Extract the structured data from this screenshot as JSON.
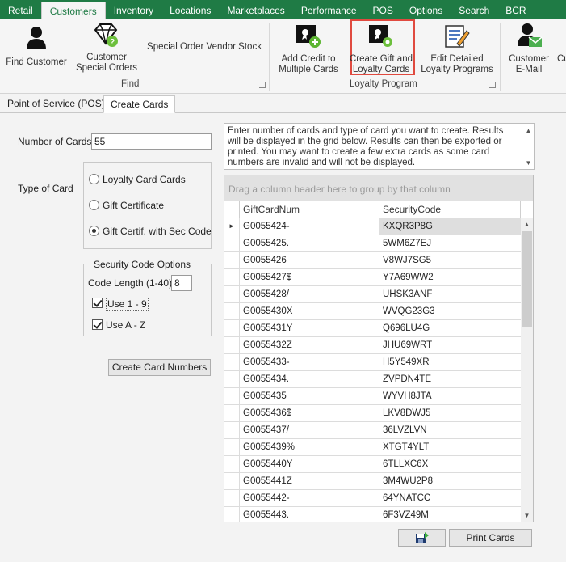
{
  "menu": {
    "tabs": [
      "Retail",
      "Customers",
      "Inventory",
      "Locations",
      "Marketplaces",
      "Performance",
      "POS",
      "Options",
      "Search",
      "BCR"
    ],
    "active_index": 1
  },
  "ribbon": {
    "find_group": {
      "label": "Find",
      "find_customer": "Find Customer",
      "customer_special_orders_1": "Customer",
      "customer_special_orders_2": "Special Orders",
      "special_order_vendor_stock": "Special Order Vendor Stock"
    },
    "loyalty_group": {
      "label": "Loyalty Program",
      "add_credit_1": "Add Credit to",
      "add_credit_2": "Multiple Cards",
      "create_gift_1": "Create Gift and",
      "create_gift_2": "Loyalty Cards",
      "edit_detailed_1": "Edit Detailed",
      "edit_detailed_2": "Loyalty Programs"
    },
    "customer_email_1": "Customer",
    "customer_email_2": "E-Mail",
    "cut_off": "Cu"
  },
  "subtabs": [
    "Point of Service (POS)",
    "Create Cards"
  ],
  "form": {
    "number_of_cards_label": "Number of Cards",
    "number_of_cards_value": "55",
    "type_of_card_label": "Type of Card",
    "card_types": [
      "Loyalty Card Cards",
      "Gift Certificate",
      "Gift Certif. with Sec Code"
    ],
    "selected_card_type": 2,
    "security_code_options_label": "Security Code Options",
    "code_length_label": "Code Length (1-40)",
    "code_length_value": "8",
    "use_1_9_label": "Use 1 - 9",
    "use_a_z_label": "Use A - Z",
    "create_button": "Create Card Numbers"
  },
  "info_text_lines": [
    "Enter number of cards and type of card you want to create.  Results",
    "will be displayed in the grid below.  Results can then be exported or",
    "printed.  You may want to create a few extra cards as some card",
    "numbers are invalid and will not be displayed."
  ],
  "grid": {
    "group_panel_text": "Drag a column header here to group by that column",
    "columns": [
      "GiftCardNum",
      "SecurityCode"
    ],
    "rows": [
      [
        "G0055424-",
        "KXQR3P8G"
      ],
      [
        "G0055425.",
        "5WM6Z7EJ"
      ],
      [
        "G0055426",
        "V8WJ7SG5"
      ],
      [
        "G0055427$",
        "Y7A69WW2"
      ],
      [
        "G0055428/",
        "UHSK3ANF"
      ],
      [
        "G0055430X",
        "WVQG23G3"
      ],
      [
        "G0055431Y",
        "Q696LU4G"
      ],
      [
        "G0055432Z",
        "JHU69WRT"
      ],
      [
        "G0055433-",
        "H5Y549XR"
      ],
      [
        "G0055434.",
        "ZVPDN4TE"
      ],
      [
        "G0055435",
        "WYVH8JTA"
      ],
      [
        "G0055436$",
        "LKV8DWJ5"
      ],
      [
        "G0055437/",
        "36LVZLVN"
      ],
      [
        "G0055439%",
        "XTGT4YLT"
      ],
      [
        "G0055440Y",
        "6TLLXC6X"
      ],
      [
        "G0055441Z",
        "3M4WU2P8"
      ],
      [
        "G0055442-",
        "64YNATCC"
      ],
      [
        "G0055443.",
        "6F3VZ49M"
      ]
    ]
  },
  "bottom": {
    "print_cards": "Print Cards"
  }
}
